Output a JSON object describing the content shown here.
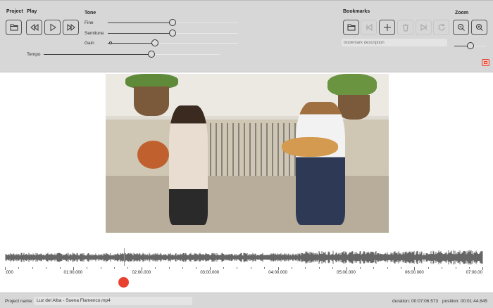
{
  "toolbar": {
    "project_label": "Project",
    "play_label": "Play",
    "tone_label": "Tone",
    "fine_label": "Fine",
    "semitone_label": "Semitone",
    "gain_label": "Gain",
    "tempo_label": "Tempo",
    "bookmarks_label": "Bookmarks",
    "zoom_label": "Zoom",
    "bookmark_placeholder": "Bookmark description",
    "sliders": {
      "fine": 0.5,
      "semitone": 0.5,
      "gain": 0.36,
      "tempo": 0.61,
      "zoom": 0.5
    }
  },
  "timeline": {
    "labels": [
      ":000",
      "01:00.000",
      "02:00.000",
      "03:00.000",
      "04:00.000",
      "05:00.000",
      "06:00.000",
      "07:00.00"
    ],
    "playhead_seconds": 104.845,
    "total_seconds": 420
  },
  "status": {
    "project_name_label": "Project name:",
    "project_name_value": "Luz del Alba - Suena Flamenco.mp4",
    "duration": "duration: 00:07:06.573",
    "position": "position: 00:01:44.845"
  },
  "colors": {
    "accent_red": "#e8412f"
  }
}
